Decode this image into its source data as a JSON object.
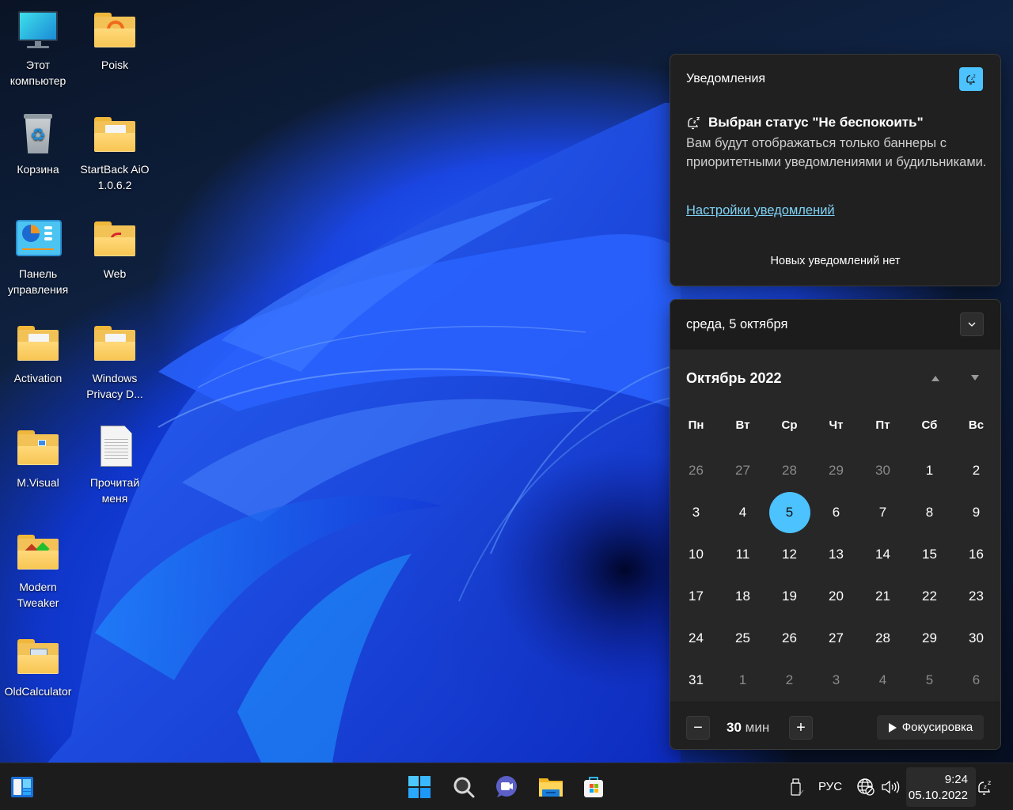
{
  "desktop": {
    "icons": [
      {
        "label": "Этот компьютер",
        "icon": "monitor-icon"
      },
      {
        "label": "Poisk",
        "icon": "folder-icon"
      },
      {
        "label": "Корзина",
        "icon": "recycle-bin-icon"
      },
      {
        "label": "StartBack AiO 1.0.6.2",
        "icon": "folder-icon"
      },
      {
        "label": "Панель управления",
        "icon": "control-panel-icon"
      },
      {
        "label": "Web",
        "icon": "folder-icon"
      },
      {
        "label": "Activation",
        "icon": "folder-icon"
      },
      {
        "label": "Windows Privacy D...",
        "icon": "folder-icon"
      },
      {
        "label": "M.Visual",
        "icon": "folder-icon"
      },
      {
        "label": "Прочитай меня",
        "icon": "text-document-icon"
      },
      {
        "label": "Modern Tweaker",
        "icon": "folder-icon"
      },
      {
        "label": "OldCalculator",
        "icon": "folder-icon"
      }
    ]
  },
  "notifications": {
    "title": "Уведомления",
    "dnd_button_icon": "do-not-disturb-bell-icon",
    "dnd_heading": "Выбран статус \"Не беспокоить\"",
    "dnd_description": "Вам будут отображаться только баннеры с приоритетными уведомлениями и будильниками.",
    "settings_link": "Настройки уведомлений",
    "empty_text": "Новых уведомлений нет"
  },
  "calendar": {
    "header_date": "среда, 5 октября",
    "month_title": "Октябрь 2022",
    "weekdays": [
      "Пн",
      "Вт",
      "Ср",
      "Чт",
      "Пт",
      "Сб",
      "Вс"
    ],
    "days": [
      {
        "d": "26",
        "other": true
      },
      {
        "d": "27",
        "other": true
      },
      {
        "d": "28",
        "other": true
      },
      {
        "d": "29",
        "other": true
      },
      {
        "d": "30",
        "other": true
      },
      {
        "d": "1"
      },
      {
        "d": "2"
      },
      {
        "d": "3"
      },
      {
        "d": "4"
      },
      {
        "d": "5",
        "today": true
      },
      {
        "d": "6"
      },
      {
        "d": "7"
      },
      {
        "d": "8"
      },
      {
        "d": "9"
      },
      {
        "d": "10"
      },
      {
        "d": "11"
      },
      {
        "d": "12"
      },
      {
        "d": "13"
      },
      {
        "d": "14"
      },
      {
        "d": "15"
      },
      {
        "d": "16"
      },
      {
        "d": "17"
      },
      {
        "d": "18"
      },
      {
        "d": "19"
      },
      {
        "d": "20"
      },
      {
        "d": "21"
      },
      {
        "d": "22"
      },
      {
        "d": "23"
      },
      {
        "d": "24"
      },
      {
        "d": "25"
      },
      {
        "d": "26"
      },
      {
        "d": "27"
      },
      {
        "d": "28"
      },
      {
        "d": "29"
      },
      {
        "d": "30"
      },
      {
        "d": "31"
      },
      {
        "d": "1",
        "other": true
      },
      {
        "d": "2",
        "other": true
      },
      {
        "d": "3",
        "other": true
      },
      {
        "d": "4",
        "other": true
      },
      {
        "d": "5",
        "other": true
      },
      {
        "d": "6",
        "other": true
      }
    ],
    "focus": {
      "minus_label": "−",
      "plus_label": "+",
      "duration_value": "30",
      "duration_unit": "мин",
      "focus_button": "Фокусировка"
    }
  },
  "colors": {
    "accent": "#4cc2ff",
    "panel_bg": "#202020",
    "link": "#7fd3f7"
  },
  "taskbar": {
    "widgets_icon": "widgets-icon",
    "pinned": [
      {
        "name": "start-button",
        "icon": "windows-logo-icon"
      },
      {
        "name": "search-button",
        "icon": "search-icon"
      },
      {
        "name": "chat-button",
        "icon": "teams-chat-icon"
      },
      {
        "name": "file-explorer-button",
        "icon": "folder-icon"
      },
      {
        "name": "store-button",
        "icon": "microsoft-store-icon"
      }
    ],
    "tray": {
      "usb_icon": "usb-drive-icon",
      "language": "РУС",
      "network_icon": "network-disconnected-icon",
      "volume_icon": "volume-icon",
      "time": "9:24",
      "date": "05.10.2022",
      "notification_icon": "do-not-disturb-bell-icon"
    }
  }
}
